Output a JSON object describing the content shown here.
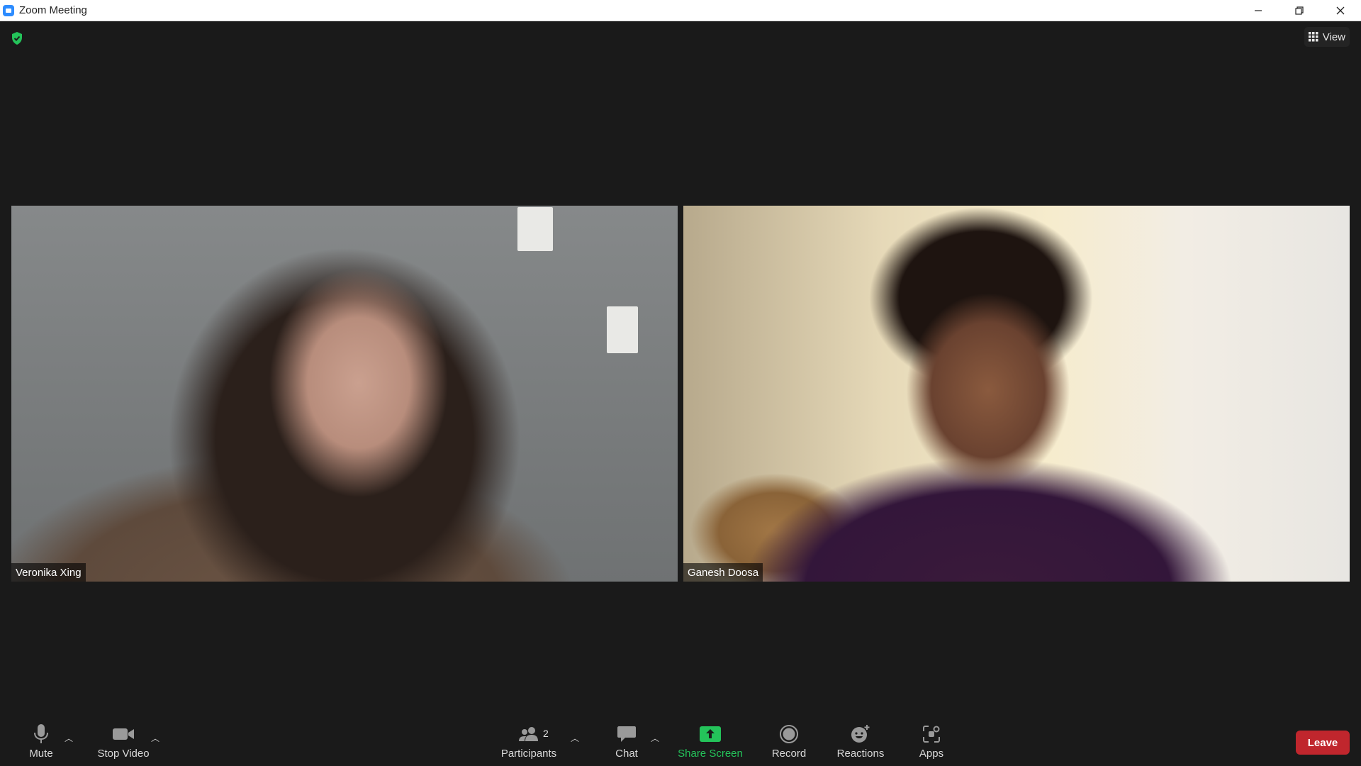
{
  "window": {
    "title": "Zoom Meeting",
    "controls": [
      "minimize",
      "restore",
      "close"
    ]
  },
  "top": {
    "security_icon": "shield-check-icon",
    "view_label": "View"
  },
  "participants": [
    {
      "name": "Veronika Xing"
    },
    {
      "name": "Ganesh Doosa"
    }
  ],
  "toolbar": {
    "mute_label": "Mute",
    "stop_video_label": "Stop Video",
    "participants_label": "Participants",
    "participants_count": "2",
    "chat_label": "Chat",
    "share_screen_label": "Share Screen",
    "record_label": "Record",
    "reactions_label": "Reactions",
    "apps_label": "Apps",
    "leave_label": "Leave"
  },
  "colors": {
    "accent_green": "#24c35a",
    "leave_red": "#c0262d",
    "zoom_blue": "#2d8cff"
  }
}
